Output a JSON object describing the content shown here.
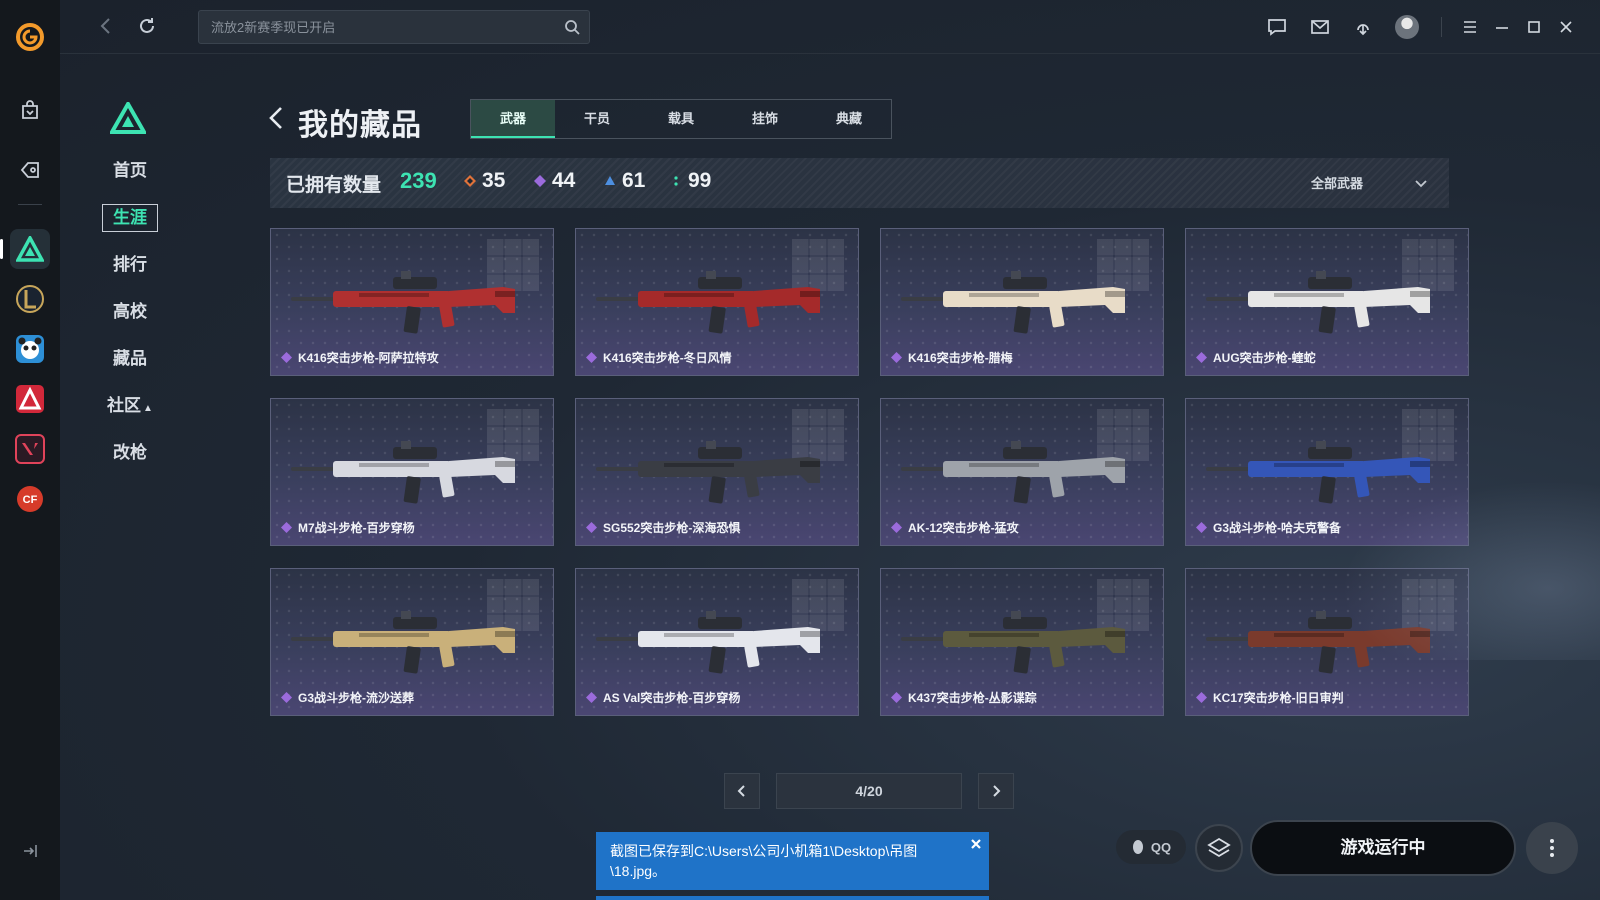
{
  "search": {
    "placeholder": "流放2新赛季现已开启"
  },
  "page": {
    "title": "我的藏品"
  },
  "subnav": {
    "items": [
      {
        "label": "首页"
      },
      {
        "label": "生涯"
      },
      {
        "label": "排行"
      },
      {
        "label": "高校"
      },
      {
        "label": "藏品"
      },
      {
        "label": "社区"
      },
      {
        "label": "改枪"
      }
    ],
    "active_index": 1
  },
  "tabs": [
    {
      "label": "武器"
    },
    {
      "label": "干员"
    },
    {
      "label": "载具"
    },
    {
      "label": "挂饰"
    },
    {
      "label": "典藏"
    }
  ],
  "stats": {
    "label": "已拥有数量",
    "total": "239",
    "rarities": [
      {
        "value": "35",
        "color": "#e0733a"
      },
      {
        "value": "44",
        "color": "#9b6bdc"
      },
      {
        "value": "61",
        "color": "#4d8fe0"
      },
      {
        "value": "99",
        "color": "#3de3b2"
      }
    ],
    "filter_label": "全部武器"
  },
  "weapons": [
    {
      "name": "K416突击步枪-阿萨拉特攻",
      "accent": "#b03030"
    },
    {
      "name": "K416突击步枪-冬日风情",
      "accent": "#a52a2a"
    },
    {
      "name": "K416突击步枪-腊梅",
      "accent": "#e8dcc8"
    },
    {
      "name": "AUG突击步枪-蝰蛇",
      "accent": "#e6e6e6"
    },
    {
      "name": "M7战斗步枪-百步穿杨",
      "accent": "#d7d9e0"
    },
    {
      "name": "SG552突击步枪-深海恐惧",
      "accent": "#3a3d44"
    },
    {
      "name": "AK-12突击步枪-猛攻",
      "accent": "#9ea3aa"
    },
    {
      "name": "G3战斗步枪-哈夫克警备",
      "accent": "#3456b8"
    },
    {
      "name": "G3战斗步枪-流沙送葬",
      "accent": "#c9b07a"
    },
    {
      "name": "AS Val突击步枪-百步穿杨",
      "accent": "#e4e6ec"
    },
    {
      "name": "K437突击步枪-丛影谍踪",
      "accent": "#5c5a3e"
    },
    {
      "name": "KC17突击步枪-旧日审判",
      "accent": "#7a3a2c"
    }
  ],
  "weapon_rarity_color": "#9b6bdc",
  "pagination": {
    "label": "4/20"
  },
  "bottom": {
    "qq_label": "QQ",
    "play_label": "游戏运行中"
  },
  "toast": {
    "message": "截图已保存到C:\\Users\\公司小机箱1\\Desktop\\吊图\\18.jpg。"
  }
}
